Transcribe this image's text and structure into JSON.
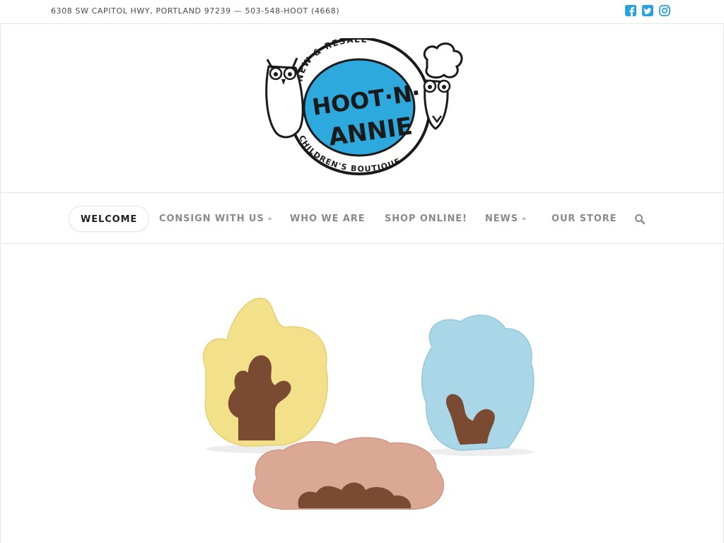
{
  "topbar": {
    "address": "6308 SW CAPITOL HWY, PORTLAND 97239 — 503-548-HOOT (4668)",
    "social": [
      {
        "icon": "facebook-icon"
      },
      {
        "icon": "twitter-icon"
      },
      {
        "icon": "instagram-icon"
      }
    ],
    "accent": "#2aa3dc"
  },
  "logo": {
    "top_arc": "NEW & RESALE",
    "line1": "HOOT·N·",
    "line2": "ANNIE",
    "bottom_arc": "CHILDREN'S BOUTIQUE",
    "fill_color": "#2ea9dd"
  },
  "nav": {
    "items": [
      {
        "label": "WELCOME",
        "active": true
      },
      {
        "label": "CONSIGN WITH US",
        "dropdown": true
      },
      {
        "label": "WHO WE ARE"
      },
      {
        "label": "SHOP ONLINE!"
      },
      {
        "label": "NEWS",
        "dropdown": true
      },
      {
        "label": "OUR STORE"
      }
    ],
    "search_icon": "search-icon"
  },
  "hero": {
    "image": "wooden-tree-puzzle-toys",
    "colors": {
      "yellow": "#f3e08a",
      "blue": "#a9d7e8",
      "pink": "#dca896",
      "walnut": "#7a4b32"
    }
  }
}
